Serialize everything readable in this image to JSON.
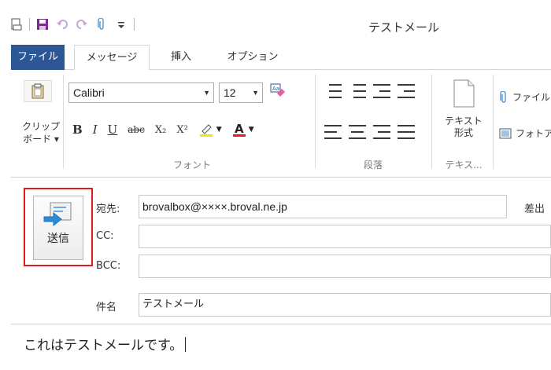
{
  "window": {
    "title": "テストメール"
  },
  "qat": {
    "icons": [
      "new-document-icon",
      "save-icon",
      "undo-icon",
      "redo-icon",
      "attach-icon",
      "customize-qat-icon"
    ]
  },
  "tabs": [
    {
      "label": "ファイル"
    },
    {
      "label": "メッセージ"
    },
    {
      "label": "挿入"
    },
    {
      "label": "オプション"
    }
  ],
  "ribbon": {
    "clipboard": {
      "paste_label": "クリップ\nボード ▾"
    },
    "font": {
      "font_name": "Calibri",
      "font_size": "12",
      "group_label": "フォント",
      "buttons": [
        "B",
        "I",
        "U",
        "abc",
        "X₂",
        "X²"
      ]
    },
    "paragraph": {
      "group_label": "段落"
    },
    "text": {
      "button_label": "テキスト\n形式",
      "group_label": "テキス..."
    },
    "attach": {
      "file_label": "ファイル",
      "photo_label": "フォトア"
    }
  },
  "compose": {
    "send_label": "送信",
    "to_label": "宛先:",
    "to_value": "brovalbox@××××.broval.ne.jp",
    "cc_label": "CC:",
    "cc_value": "",
    "bcc_label": "BCC:",
    "bcc_value": "",
    "subject_label": "件名",
    "subject_value": "テストメール",
    "from_label": "差出",
    "body": "これはテストメールです。"
  },
  "colors": {
    "file_tab": "#2b5797",
    "highlight": "#e01b1b",
    "text_highlight_yellow": "#f5e600",
    "font_color_red": "#e01b1b"
  }
}
